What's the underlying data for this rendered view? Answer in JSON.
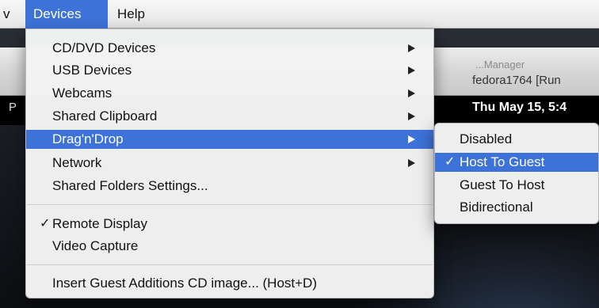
{
  "menubar": {
    "items": [
      {
        "label": "v"
      },
      {
        "label": "Devices"
      },
      {
        "label": "Help"
      }
    ]
  },
  "background": {
    "faded_title": "...Manager",
    "vm_title": "fedora1764 [Run",
    "guest_panel_left": "P",
    "guest_clock": "Thu May 15,  5:4"
  },
  "devices_menu": {
    "items": [
      {
        "label": "CD/DVD Devices",
        "has_submenu": true
      },
      {
        "label": "USB Devices",
        "has_submenu": true
      },
      {
        "label": "Webcams",
        "has_submenu": true
      },
      {
        "label": "Shared Clipboard",
        "has_submenu": true
      },
      {
        "label": "Drag'n'Drop",
        "has_submenu": true,
        "highlighted": true
      },
      {
        "label": "Network",
        "has_submenu": true
      },
      {
        "label": "Shared Folders Settings..."
      },
      {
        "label": "Remote Display",
        "checked": true,
        "check": "✓"
      },
      {
        "label": "Video Capture"
      },
      {
        "label": "Insert Guest Additions CD image... (Host+D)"
      }
    ]
  },
  "dragndrop_submenu": {
    "items": [
      {
        "label": "Disabled"
      },
      {
        "label": "Host To Guest",
        "checked": true,
        "check": "✓",
        "highlighted": true
      },
      {
        "label": "Guest To Host"
      },
      {
        "label": "Bidirectional"
      }
    ]
  },
  "colors": {
    "highlight": "#3d72d8",
    "menu_bg": "#f3f3f3"
  }
}
